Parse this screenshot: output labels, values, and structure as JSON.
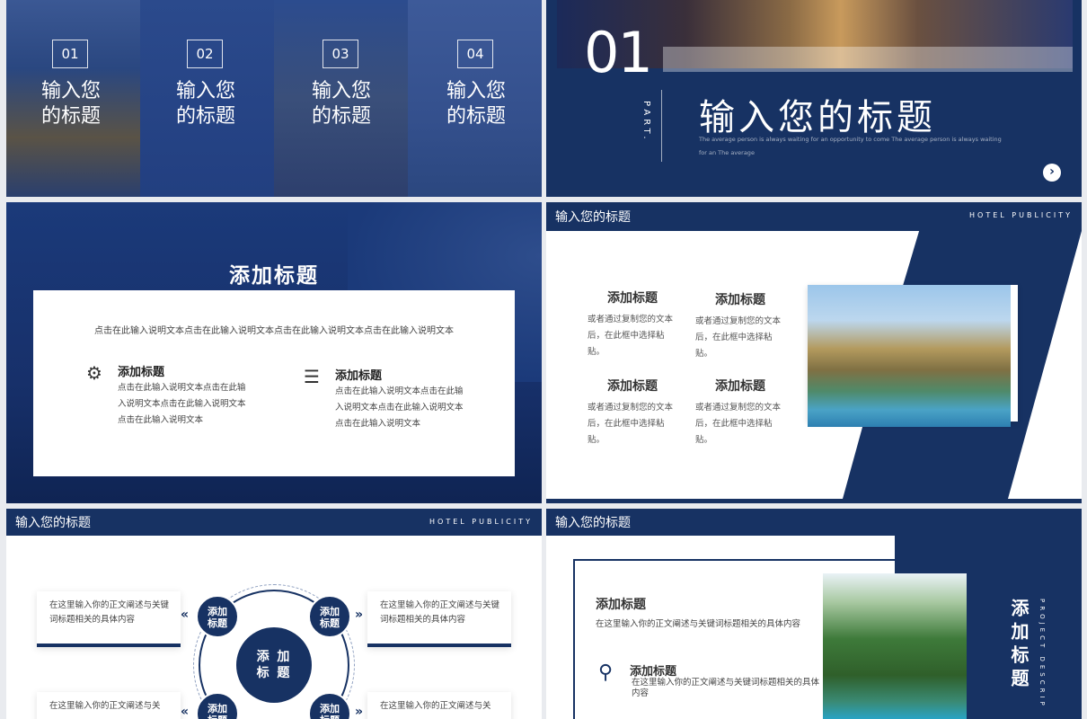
{
  "slide1": {
    "columns": [
      {
        "num": "01",
        "title": "输入您的标题"
      },
      {
        "num": "02",
        "title": "输入您的标题"
      },
      {
        "num": "03",
        "title": "输入您的标题"
      },
      {
        "num": "04",
        "title": "输入您的标题"
      }
    ]
  },
  "slide2": {
    "number": "01",
    "part": "PART.",
    "title": "输入您的标题",
    "subtitle": "The average person is always waiting for an opportunity to come The average person is always waiting for an The average"
  },
  "slide3": {
    "heading": "添加标题",
    "intro": "点击在此输入说明文本点击在此输入说明文本点击在此输入说明文本点击在此输入说明文本",
    "features": [
      {
        "title": "添加标题",
        "desc": "点击在此输入说明文本点击在此输入说明文本点击在此输入说明文本点击在此输入说明文本",
        "icon": "gear-icon"
      },
      {
        "title": "添加标题",
        "desc": "点击在此输入说明文本点击在此输入说明文本点击在此输入说明文本点击在此输入说明文本",
        "icon": "sliders-icon"
      }
    ]
  },
  "slide4": {
    "title": "输入您的标题",
    "tag": "HOTEL PUBLICITY",
    "blocks": [
      {
        "title": "添加标题",
        "desc": "或者通过复制您的文本后，在此框中选择粘贴。"
      },
      {
        "title": "添加标题",
        "desc": "或者通过复制您的文本后，在此框中选择粘贴。"
      },
      {
        "title": "添加标题",
        "desc": "或者通过复制您的文本后，在此框中选择粘贴。"
      },
      {
        "title": "添加标题",
        "desc": "或者通过复制您的文本后，在此框中选择粘贴。"
      }
    ]
  },
  "slide5": {
    "title": "输入您的标题",
    "tag": "HOTEL PUBLICITY",
    "center": "添 加\n标 题",
    "nodes": [
      "添加\n标题",
      "添加\n标题",
      "添加\n标题",
      "添加\n标题"
    ],
    "cards": [
      "在这里输入你的正文阐述与关键词标题相关的具体内容",
      "在这里输入你的正文阐述与关键词标题相关的具体内容",
      "在这里输入你的正文阐述与关",
      "在这里输入你的正文阐述与关"
    ]
  },
  "slide6": {
    "title": "输入您的标题",
    "heading1": "添加标题",
    "desc1": "在这里输入你的正文阐述与关键词标题相关的具体内容",
    "heading2": "添加标题",
    "desc2": "在这里输入你的正文阐述与关键词标题相关的具体内容",
    "vertical_title": "添加标题",
    "vertical_sub": "PROJECT DESCRIP"
  }
}
